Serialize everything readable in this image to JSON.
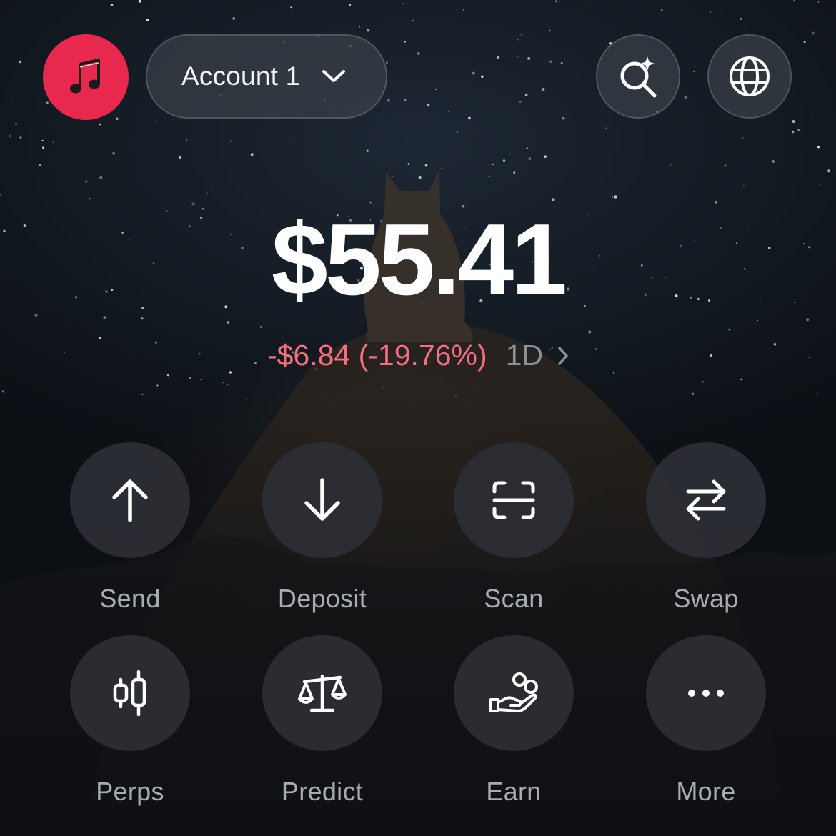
{
  "header": {
    "avatar_icon": "music-note-icon",
    "avatar_color": "#e8294d",
    "account_name": "Account 1",
    "account_dropdown_icon": "chevron-down-icon",
    "search_icon": "ai-search-icon",
    "network_icon": "globe-icon"
  },
  "balance": {
    "amount": "$55.41",
    "change": "-$6.84 (-19.76%)",
    "change_color": "#f3707f",
    "period": "1D",
    "period_icon": "chevron-right-icon"
  },
  "actions": [
    {
      "label": "Send",
      "icon": "arrow-up-icon"
    },
    {
      "label": "Deposit",
      "icon": "arrow-down-icon"
    },
    {
      "label": "Scan",
      "icon": "scan-icon"
    },
    {
      "label": "Swap",
      "icon": "swap-arrows-icon"
    },
    {
      "label": "Perps",
      "icon": "candlestick-icon"
    },
    {
      "label": "Predict",
      "icon": "scale-icon"
    },
    {
      "label": "Earn",
      "icon": "hand-coins-icon"
    },
    {
      "label": "More",
      "icon": "more-dots-icon"
    }
  ]
}
